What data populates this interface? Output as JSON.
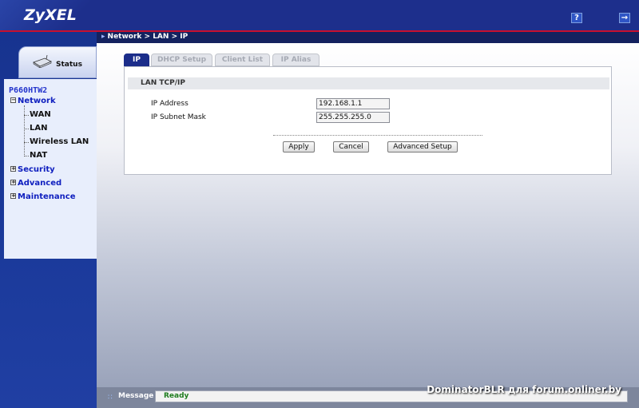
{
  "app": {
    "logo": "ZyXEL",
    "help_icon": "question-mark-icon",
    "logout_icon": "logout-icon",
    "colors": {
      "header": "#1d2f8c",
      "accent_line": "#c8102e",
      "menu_link": "#1020bf",
      "ready": "#1f7d1f"
    }
  },
  "breadcrumb": {
    "text": "Network > LAN > IP"
  },
  "sidebar": {
    "status_label": "Status",
    "device": "P660HTW2",
    "network": {
      "label": "Network",
      "expanded": true,
      "items": [
        {
          "label": "WAN"
        },
        {
          "label": "LAN"
        },
        {
          "label": "Wireless LAN"
        },
        {
          "label": "NAT"
        }
      ]
    },
    "security": {
      "label": "Security"
    },
    "advanced": {
      "label": "Advanced"
    },
    "maintenance": {
      "label": "Maintenance"
    }
  },
  "tabs": [
    {
      "label": "IP",
      "active": true
    },
    {
      "label": "DHCP Setup",
      "active": false
    },
    {
      "label": "Client List",
      "active": false
    },
    {
      "label": "IP Alias",
      "active": false
    }
  ],
  "panel": {
    "title": "LAN TCP/IP",
    "fields": [
      {
        "label": "IP Address",
        "value": "192.168.1.1"
      },
      {
        "label": "IP Subnet Mask",
        "value": "255.255.255.0"
      }
    ],
    "buttons": {
      "apply": "Apply",
      "cancel": "Cancel",
      "advanced": "Advanced Setup"
    }
  },
  "status_bar": {
    "label": "Message",
    "value": "Ready"
  },
  "watermark": "DominatorBLR для forum.onliner.by"
}
